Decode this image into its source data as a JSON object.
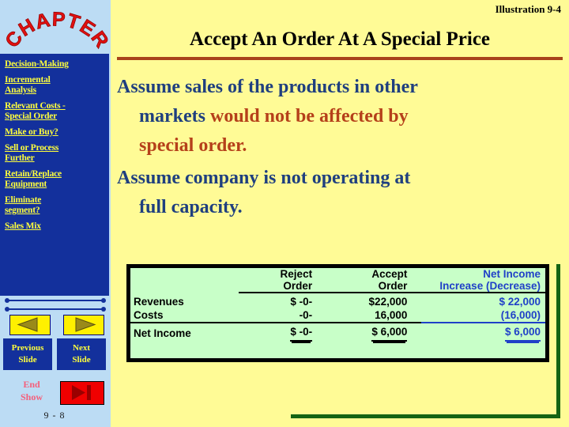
{
  "sidebar": {
    "logo_text": "CHAPTER",
    "nav_items": [
      {
        "name": "decision-making",
        "lines": [
          "Decision-Making"
        ]
      },
      {
        "name": "incremental-analysis",
        "lines": [
          "Incremental",
          "Analysis"
        ]
      },
      {
        "name": "relevant-costs-special-order",
        "lines": [
          "Relevant Costs -",
          "Special Order"
        ]
      },
      {
        "name": "make-or-buy",
        "lines": [
          "Make or Buy?"
        ]
      },
      {
        "name": "sell-or-process-further",
        "lines": [
          "Sell or Process",
          "Further"
        ]
      },
      {
        "name": "retain-replace-equipment",
        "lines": [
          "Retain/Replace",
          "Equipment"
        ]
      },
      {
        "name": "eliminate-segment",
        "lines": [
          "Eliminate",
          "segment?"
        ]
      },
      {
        "name": "sales-mix",
        "lines": [
          "Sales Mix"
        ]
      }
    ],
    "previous_slide": {
      "line1": "Previous",
      "line2": "Slide"
    },
    "next_slide": {
      "line1": "Next",
      "line2": "Slide"
    },
    "end_show": {
      "line1": "End",
      "line2": "Show"
    },
    "slide_number": "9 - 8",
    "icons": {
      "previous_arrow": "triangle-left-icon",
      "next_arrow": "triangle-right-icon",
      "end_show": "skip-to-end-icon"
    }
  },
  "main": {
    "illustration_label": "Illustration 9-4",
    "title": "Accept An Order At A Special Price",
    "bullets": [
      {
        "name": "bullet-assume-sales",
        "line1_plain": "Assume sales of the products in other",
        "line2_plain": "markets ",
        "line2_highlight": "would not be affected by",
        "line3_highlight": "special order."
      },
      {
        "name": "bullet-assume-capacity",
        "line1_plain": "Assume company is not operating at",
        "line2_plain": "full capacity."
      }
    ]
  },
  "table": {
    "name": "incremental-analysis-table",
    "headers": [
      {
        "line1": "",
        "line2": ""
      },
      {
        "line1": "Reject",
        "line2": "Order"
      },
      {
        "line1": "Accept",
        "line2": "Order"
      },
      {
        "line1": "Net Income",
        "line2": "Increase (Decrease)"
      }
    ],
    "rows": [
      {
        "label": "Revenues",
        "reject": "$ -0-",
        "accept": "$22,000",
        "net": "$ 22,000"
      },
      {
        "label": "Costs",
        "reject": "-0-",
        "accept": "16,000",
        "net": "(16,000)"
      },
      {
        "label": "Net Income",
        "reject": "$ -0-",
        "accept": "$  6,000",
        "net": "$    6,000"
      }
    ]
  },
  "colors": {
    "slide_bg": "#FFFB96",
    "sidebar_bg": "#BCDCF4",
    "nav_panel_bg": "#13309C",
    "nav_link": "#FFFF3C",
    "title_rule": "#A8431B",
    "bullet_primary": "#1F3F7F",
    "bullet_highlight": "#B5401A",
    "table_bg": "#C8FFC8",
    "table_net_text": "#2040C8",
    "green_accent": "#146414",
    "logo_text": "#E01010"
  }
}
